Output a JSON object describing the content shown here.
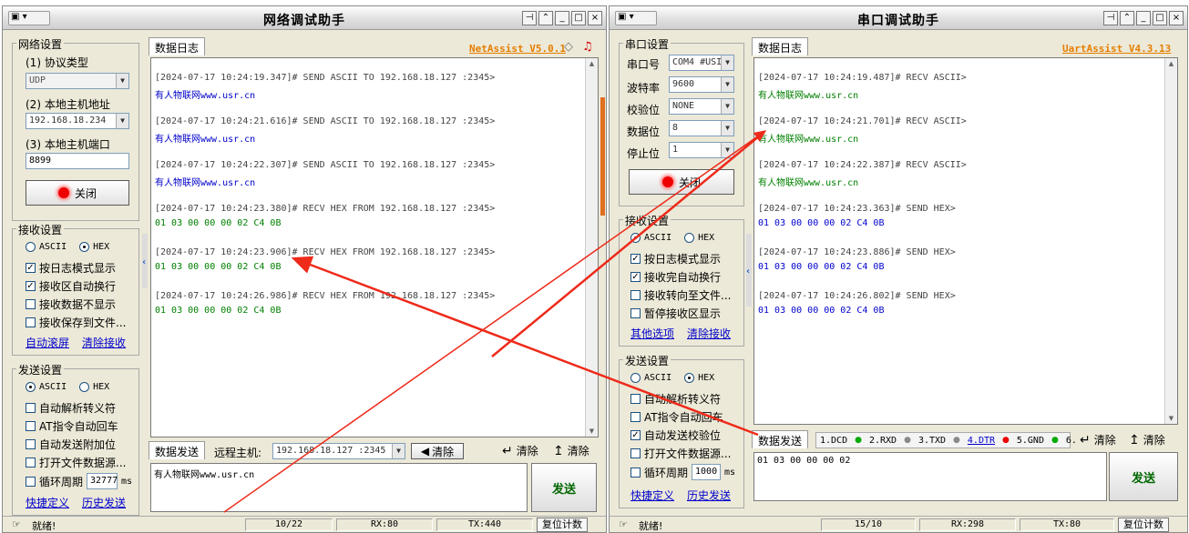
{
  "net": {
    "title": "网络调试助手",
    "brand": "NetAssist V5.0.1",
    "network_settings": {
      "group_title": "网络设置",
      "protocol_label": "(1) 协议类型",
      "protocol_value": "UDP",
      "host_label": "(2) 本地主机地址",
      "host_value": "192.168.18.234",
      "port_label": "(3) 本地主机端口",
      "port_value": "8899",
      "close_button": "关闭"
    },
    "receive_settings": {
      "group_title": "接收设置",
      "ascii": "ASCII",
      "hex": "HEX",
      "options": [
        "按日志模式显示",
        "接收区自动换行",
        "接收数据不显示",
        "接收保存到文件..."
      ],
      "auto_scroll": "自动滚屏",
      "clear_receive": "清除接收"
    },
    "send_settings": {
      "group_title": "发送设置",
      "ascii": "ASCII",
      "hex": "HEX",
      "options": [
        "自动解析转义符",
        "AT指令自动回车",
        "自动发送附加位",
        "打开文件数据源...",
        "循环周期"
      ],
      "cycle_value": "32777",
      "cycle_unit": "ms",
      "shortcut": "快捷定义",
      "history": "历史发送"
    },
    "log_tab": "数据日志",
    "log": [
      {
        "header": "[2024-07-17 10:24:19.347]# SEND ASCII TO 192.168.18.127 :2345>",
        "body": "有人物联网www.usr.cn",
        "type": "send"
      },
      {
        "header": "[2024-07-17 10:24:21.616]# SEND ASCII TO 192.168.18.127 :2345>",
        "body": "有人物联网www.usr.cn",
        "type": "send"
      },
      {
        "header": "[2024-07-17 10:24:22.307]# SEND ASCII TO 192.168.18.127 :2345>",
        "body": "有人物联网www.usr.cn",
        "type": "send"
      },
      {
        "header": "[2024-07-17 10:24:23.380]# RECV HEX FROM 192.168.18.127 :2345>",
        "body": "01 03 00 00 00 02 C4 0B",
        "type": "recv"
      },
      {
        "header": "[2024-07-17 10:24:23.906]# RECV HEX FROM 192.168.18.127 :2345>",
        "body": "01 03 00 00 00 02 C4 0B",
        "type": "recv"
      },
      {
        "header": "[2024-07-17 10:24:26.986]# RECV HEX FROM 192.168.18.127 :2345>",
        "body": "01 03 00 00 00 02 C4 0B",
        "type": "recv"
      }
    ],
    "send_tab": "数据发送",
    "remote_label": "远程主机:",
    "remote_value": "192.168.18.127 :2345",
    "clear_btn": "清除",
    "clear_label_1": "清除",
    "clear_label_2": "清除",
    "send_text": "有人物联网www.usr.cn",
    "send_button": "发送",
    "status": {
      "ready": "就绪!",
      "count": "10/22",
      "rx": "RX:80",
      "tx": "TX:440",
      "reset": "复位计数"
    }
  },
  "uart": {
    "title": "串口调试助手",
    "brand": "UartAssist V4.3.13",
    "serial_settings": {
      "group_title": "串口设置",
      "port_label": "串口号",
      "port_value": "COM4 #USI",
      "baud_label": "波特率",
      "baud_value": "9600",
      "parity_label": "校验位",
      "parity_value": "NONE",
      "data_label": "数据位",
      "data_value": "8",
      "stop_label": "停止位",
      "stop_value": "1",
      "close_button": "关闭"
    },
    "receive_settings": {
      "group_title": "接收设置",
      "ascii": "ASCII",
      "hex": "HEX",
      "options": [
        "按日志模式显示",
        "接收完自动换行",
        "接收转向至文件...",
        "暂停接收区显示"
      ],
      "other_options": "其他选项",
      "clear_receive": "清除接收"
    },
    "send_settings": {
      "group_title": "发送设置",
      "ascii": "ASCII",
      "hex": "HEX",
      "options": [
        "自动解析转义符",
        "AT指令自动回车",
        "自动发送校验位",
        "打开文件数据源...",
        "循环周期"
      ],
      "cycle_value": "1000",
      "cycle_unit": "ms",
      "shortcut": "快捷定义",
      "history": "历史发送"
    },
    "log_tab": "数据日志",
    "log": [
      {
        "header": "[2024-07-17 10:24:19.487]# RECV ASCII>",
        "body": "有人物联网www.usr.cn",
        "type": "recv"
      },
      {
        "header": "[2024-07-17 10:24:21.701]# RECV ASCII>",
        "body": "有人物联网www.usr.cn",
        "type": "recv"
      },
      {
        "header": "[2024-07-17 10:24:22.387]# RECV ASCII>",
        "body": "有人物联网www.usr.cn",
        "type": "recv"
      },
      {
        "header": "[2024-07-17 10:24:23.363]# SEND HEX>",
        "body": "01 03 00 00 00 02 C4 0B",
        "type": "send"
      },
      {
        "header": "[2024-07-17 10:24:23.886]# SEND HEX>",
        "body": "01 03 00 00 00 02 C4 0B",
        "type": "send"
      },
      {
        "header": "[2024-07-17 10:24:26.802]# SEND HEX>",
        "body": "01 03 00 00 00 02 C4 0B",
        "type": "send"
      }
    ],
    "send_tab": "数据发送",
    "pins": [
      "1.DCD",
      "2.RXD",
      "3.TXD",
      "4.DTR",
      "5.GND",
      "6."
    ],
    "clear_label_1": "清除",
    "clear_label_2": "清除",
    "send_text": "01 03 00 00 00 02",
    "send_button": "发送",
    "status": {
      "ready": "就绪!",
      "count": "15/10",
      "rx": "RX:298",
      "tx": "TX:80",
      "reset": "复位计数"
    }
  },
  "colors": {
    "send_text": "#0000cc",
    "recv_text": "#008000",
    "brand": "#e67e00",
    "annotation_arrow": "#ee2a1a"
  }
}
